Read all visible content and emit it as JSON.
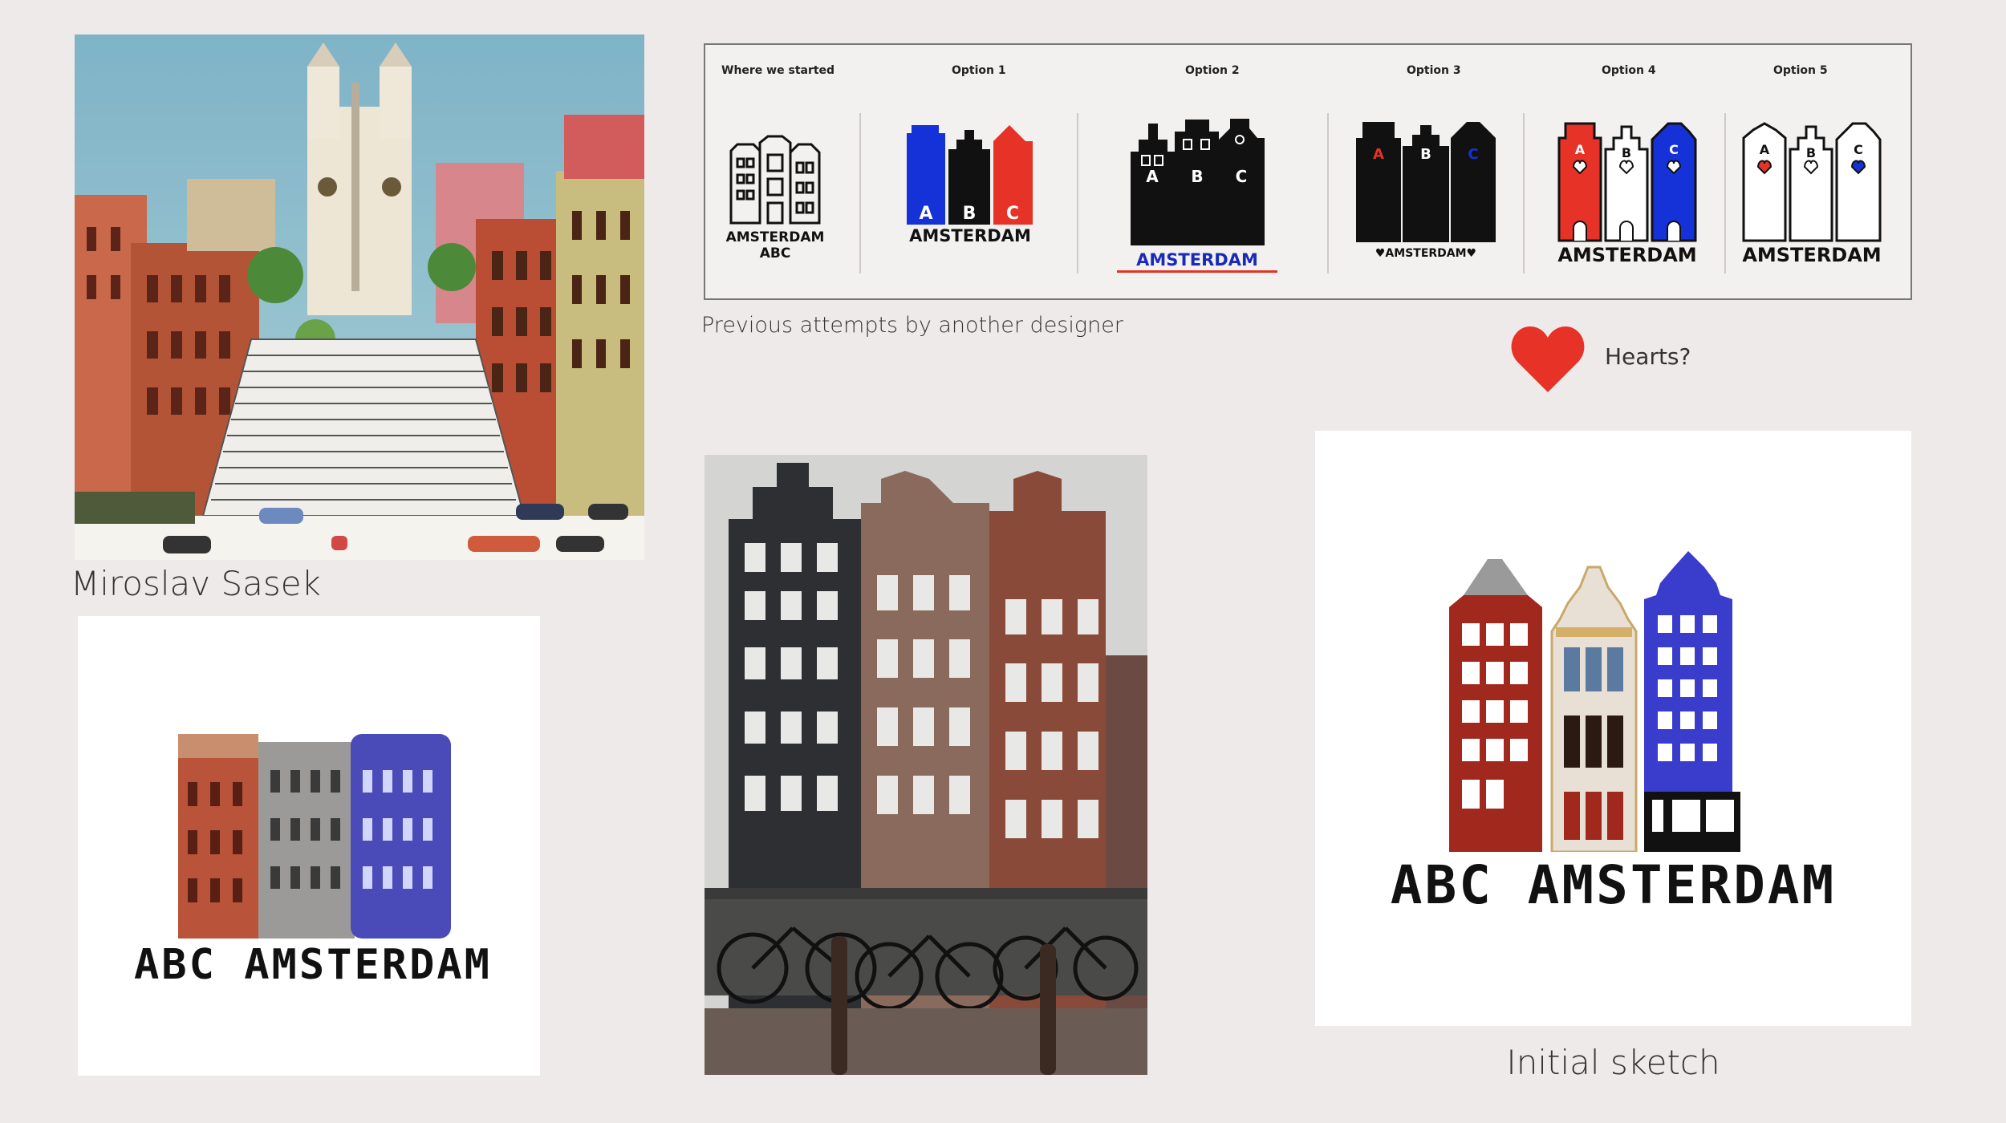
{
  "captions": {
    "sasek": "Miroslav Sasek",
    "previous": "Previous attempts by another designer",
    "hearts": "Hearts?",
    "sketch": "Initial sketch"
  },
  "panel": {
    "options": [
      {
        "label": "Where we started",
        "wordmark_line1": "AMSTERDAM",
        "wordmark_line2": "ABC"
      },
      {
        "label": "Option 1",
        "wordmark": "AMSTERDAM",
        "letters": [
          "A",
          "B",
          "C"
        ]
      },
      {
        "label": "Option 2",
        "wordmark": "AMSTERDAM",
        "letters": [
          "A",
          "B",
          "C"
        ]
      },
      {
        "label": "Option 3",
        "wordmark": "♥AMSTERDAM♥",
        "letters": [
          "A",
          "B",
          "C"
        ]
      },
      {
        "label": "Option 4",
        "wordmark": "AMSTERDAM",
        "letters": [
          "A",
          "B",
          "C"
        ]
      },
      {
        "label": "Option 5",
        "wordmark": "AMSTERDAM",
        "letters": [
          "A",
          "B",
          "C"
        ]
      }
    ]
  },
  "logos": {
    "collage_text": "ABC AMSTERDAM",
    "sketch_text": "ABC AMSTERDAM"
  },
  "colors": {
    "background": "#efeaea",
    "red": "#e63227",
    "blue": "#1432d8",
    "heart": "#e63227",
    "brick": "#a0281c",
    "sketch_blue": "#3a3ccc"
  },
  "icons": {
    "heart": "heart-icon"
  }
}
